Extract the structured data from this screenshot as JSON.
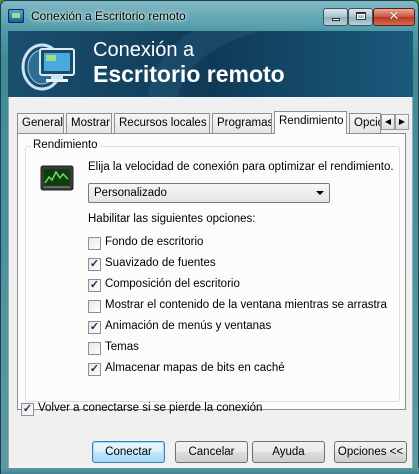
{
  "window": {
    "title": "Conexión a Escritorio remoto",
    "minimize_glyph": "",
    "close_glyph": "✕"
  },
  "banner": {
    "line1": "Conexión a",
    "line2": "Escritorio remoto"
  },
  "tabs": [
    {
      "label": "General",
      "active": false
    },
    {
      "label": "Mostrar",
      "active": false
    },
    {
      "label": "Recursos locales",
      "active": false
    },
    {
      "label": "Programas",
      "active": false
    },
    {
      "label": "Rendimiento",
      "active": true
    },
    {
      "label": "Opcio",
      "active": false
    }
  ],
  "tab_scroll": {
    "left": "◀",
    "right": "▶"
  },
  "performance": {
    "group_label": "Rendimiento",
    "prompt": "Elija la velocidad de conexión para optimizar el rendimiento.",
    "speed_select": {
      "value": "Personalizado"
    },
    "options_label": "Habilitar las siguientes opciones:",
    "options": [
      {
        "label": "Fondo de escritorio",
        "checked": false
      },
      {
        "label": "Suavizado de fuentes",
        "checked": true
      },
      {
        "label": "Composición del escritorio",
        "checked": true
      },
      {
        "label": "Mostrar el contenido de la ventana mientras se arrastra",
        "checked": false
      },
      {
        "label": "Animación de menús y ventanas",
        "checked": true
      },
      {
        "label": "Temas",
        "checked": false
      },
      {
        "label": "Almacenar mapas de bits en caché",
        "checked": true
      }
    ]
  },
  "reconnect": {
    "label": "Volver a conectarse si se pierde la conexión",
    "checked": true
  },
  "buttons": {
    "connect": "Conectar",
    "cancel": "Cancelar",
    "help": "Ayuda",
    "options": "Opciones <<"
  },
  "colors": {
    "banner": "#0f3a57",
    "default_button": "#bee6fd",
    "check": "#1a2b5a"
  }
}
